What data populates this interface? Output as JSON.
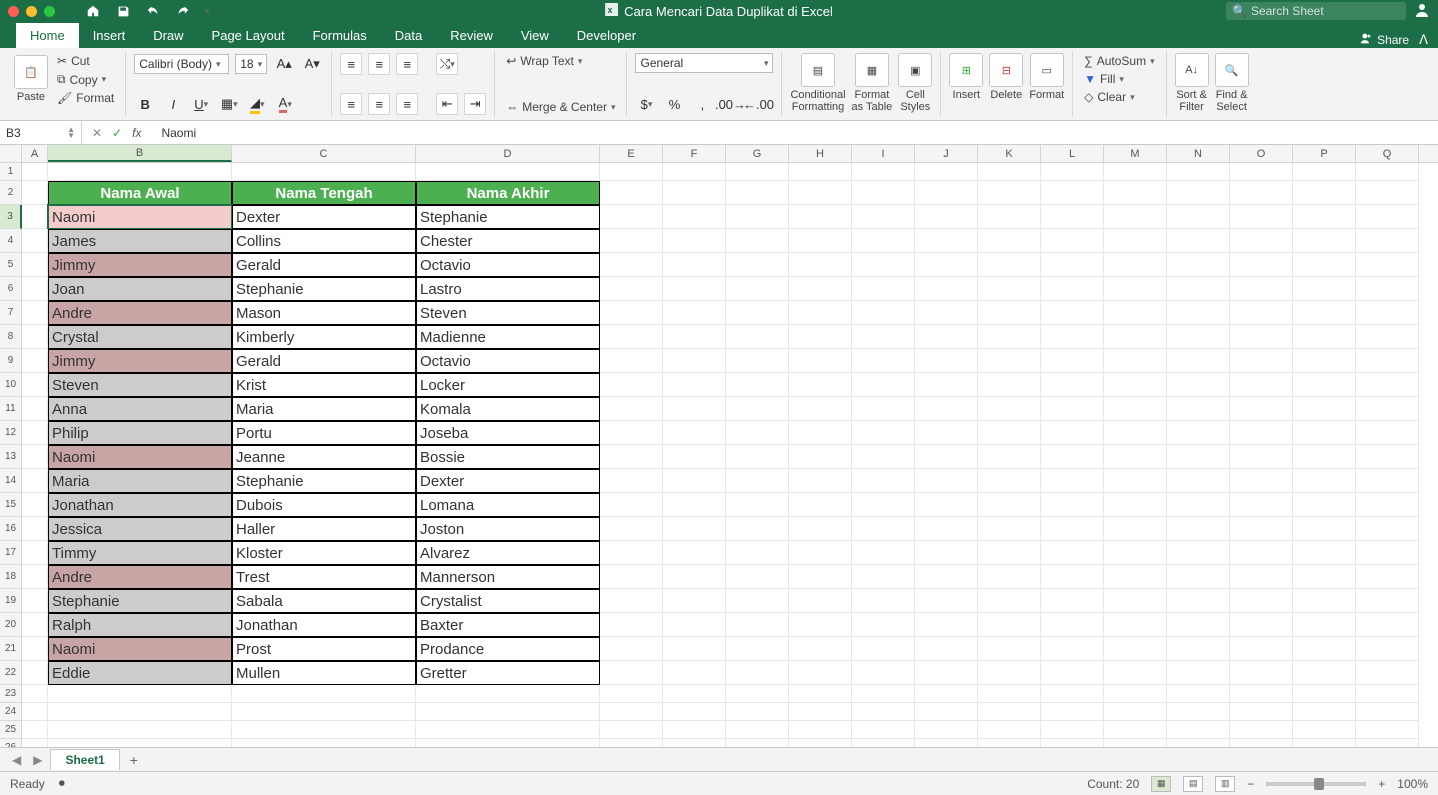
{
  "titlebar": {
    "doc_icon": "excel-doc-icon",
    "title": "Cara Mencari Data Duplikat di Excel",
    "search_placeholder": "Search Sheet"
  },
  "qat": {
    "items": [
      "home-icon",
      "save-icon",
      "undo-icon",
      "redo-icon"
    ]
  },
  "tabs": {
    "items": [
      "Home",
      "Insert",
      "Draw",
      "Page Layout",
      "Formulas",
      "Data",
      "Review",
      "View",
      "Developer"
    ],
    "active": "Home",
    "share": "Share"
  },
  "ribbon": {
    "paste": "Paste",
    "cut": "Cut",
    "copy": "Copy",
    "format_painter": "Format",
    "font_name": "Calibri (Body)",
    "font_size": "18",
    "bold": "B",
    "italic": "I",
    "underline": "U",
    "wrap": "Wrap Text",
    "merge": "Merge & Center",
    "number_format": "General",
    "cond_fmt": "Conditional\nFormatting",
    "as_table": "Format\nas Table",
    "cell_styles": "Cell\nStyles",
    "insert": "Insert",
    "delete": "Delete",
    "format": "Format",
    "autosum": "AutoSum",
    "fill": "Fill",
    "clear": "Clear",
    "sort": "Sort &\nFilter",
    "find": "Find &\nSelect"
  },
  "formula": {
    "name_box": "B3",
    "value": "Naomi"
  },
  "columns": [
    "A",
    "B",
    "C",
    "D",
    "E",
    "F",
    "G",
    "H",
    "I",
    "J",
    "K",
    "L",
    "M",
    "N",
    "O",
    "P",
    "Q"
  ],
  "col_widths": {
    "A": 26,
    "default": 63,
    "B": 184,
    "C": 184,
    "D": 184
  },
  "table": {
    "header_row": 2,
    "headers": [
      "Nama Awal",
      "Nama Tengah",
      "Nama Akhir"
    ],
    "active": {
      "col": "B",
      "row": 3
    },
    "rows": [
      {
        "r": 3,
        "b": "Naomi",
        "c": "Dexter",
        "d": "Stephanie",
        "b_fill": "pink"
      },
      {
        "r": 4,
        "b": "James",
        "c": "Collins",
        "d": "Chester",
        "b_fill": "grey"
      },
      {
        "r": 5,
        "b": "Jimmy",
        "c": "Gerald",
        "d": "Octavio",
        "b_fill": "mauve"
      },
      {
        "r": 6,
        "b": "Joan",
        "c": "Stephanie",
        "d": "Lastro",
        "b_fill": "grey"
      },
      {
        "r": 7,
        "b": "Andre",
        "c": "Mason",
        "d": "Steven",
        "b_fill": "mauve"
      },
      {
        "r": 8,
        "b": "Crystal",
        "c": "Kimberly",
        "d": "Madienne",
        "b_fill": "grey"
      },
      {
        "r": 9,
        "b": "Jimmy",
        "c": "Gerald",
        "d": "Octavio",
        "b_fill": "mauve"
      },
      {
        "r": 10,
        "b": "Steven",
        "c": "Krist",
        "d": "Locker",
        "b_fill": "grey"
      },
      {
        "r": 11,
        "b": "Anna",
        "c": "Maria",
        "d": "Komala",
        "b_fill": "grey"
      },
      {
        "r": 12,
        "b": "Philip",
        "c": "Portu",
        "d": "Joseba",
        "b_fill": "grey"
      },
      {
        "r": 13,
        "b": "Naomi",
        "c": "Jeanne",
        "d": "Bossie",
        "b_fill": "mauve"
      },
      {
        "r": 14,
        "b": "Maria",
        "c": "Stephanie",
        "d": "Dexter",
        "b_fill": "grey"
      },
      {
        "r": 15,
        "b": "Jonathan",
        "c": "Dubois",
        "d": "Lomana",
        "b_fill": "grey"
      },
      {
        "r": 16,
        "b": "Jessica",
        "c": "Haller",
        "d": "Joston",
        "b_fill": "grey"
      },
      {
        "r": 17,
        "b": "Timmy",
        "c": "Kloster",
        "d": "Alvarez",
        "b_fill": "grey"
      },
      {
        "r": 18,
        "b": "Andre",
        "c": "Trest",
        "d": "Mannerson",
        "b_fill": "mauve"
      },
      {
        "r": 19,
        "b": "Stephanie",
        "c": "Sabala",
        "d": "Crystalist",
        "b_fill": "grey"
      },
      {
        "r": 20,
        "b": "Ralph",
        "c": "Jonathan",
        "d": "Baxter",
        "b_fill": "grey"
      },
      {
        "r": 21,
        "b": "Naomi",
        "c": "Prost",
        "d": "Prodance",
        "b_fill": "mauve"
      },
      {
        "r": 22,
        "b": "Eddie",
        "c": "Mullen",
        "d": "Gretter",
        "b_fill": "grey"
      }
    ],
    "total_rows_visible": 26
  },
  "sheet": {
    "name": "Sheet1"
  },
  "status": {
    "ready": "Ready",
    "count": "Count: 20",
    "zoom": "100%"
  }
}
